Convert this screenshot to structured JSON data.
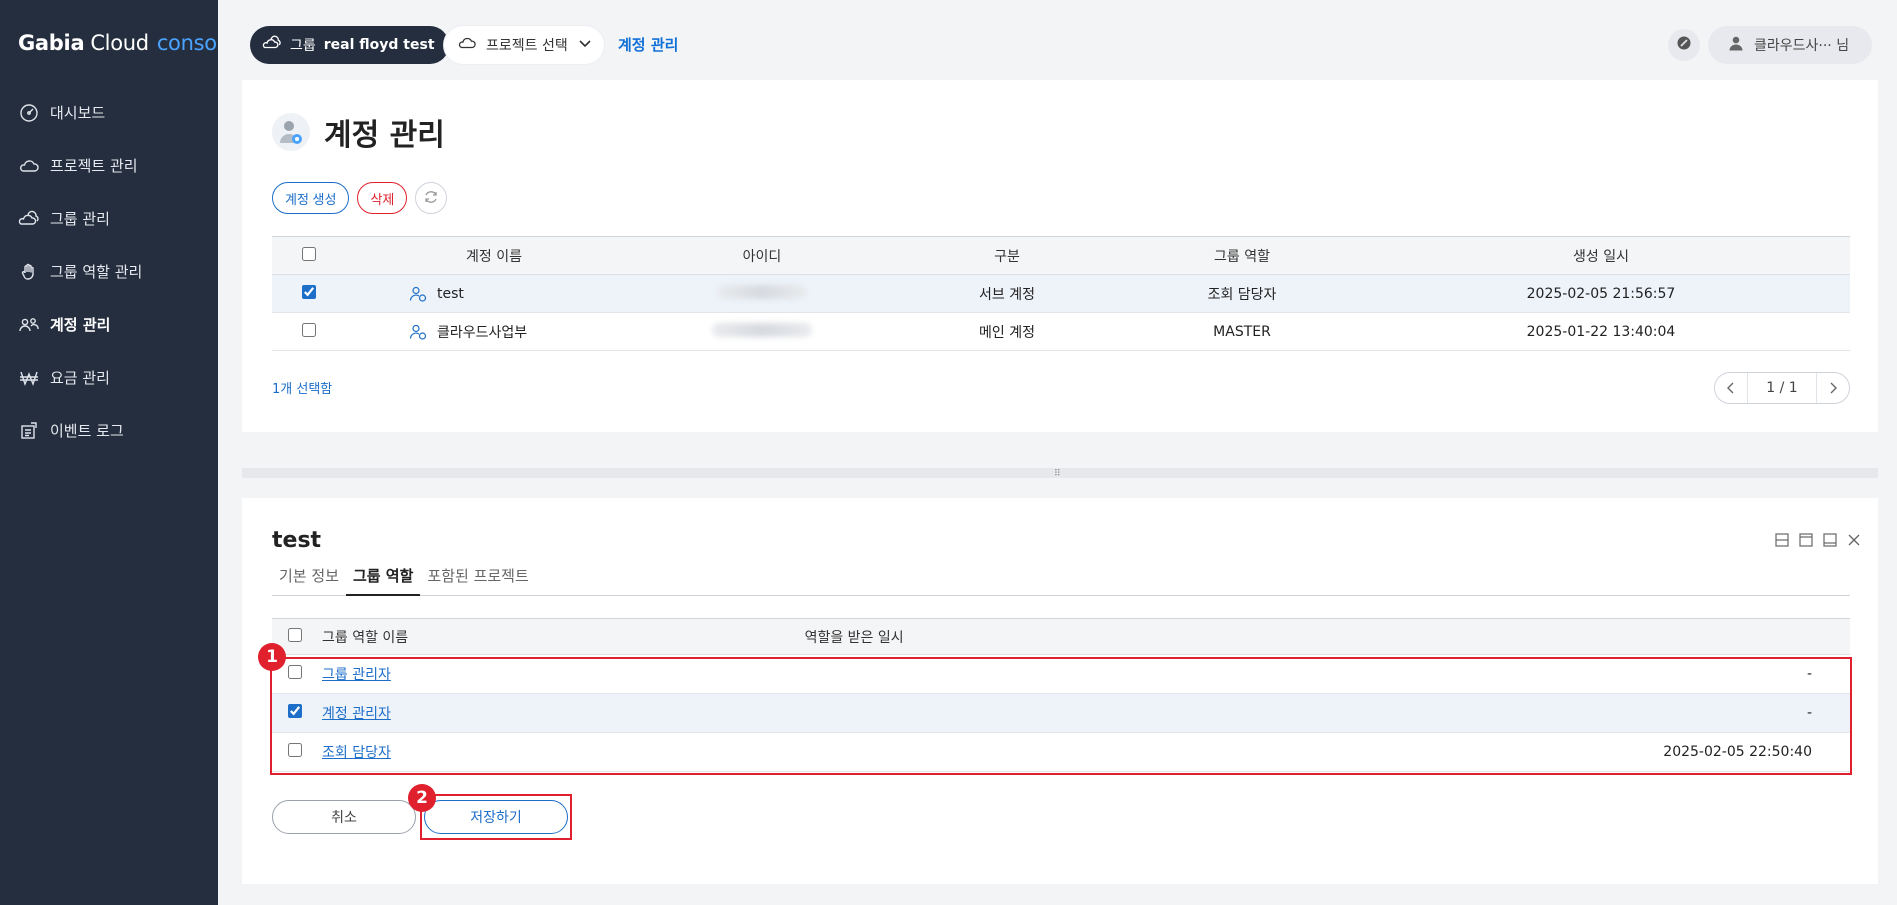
{
  "sidebar": {
    "logo": {
      "brand": "Gabia",
      "product": "Cloud",
      "suffix": "console"
    },
    "items": [
      {
        "label": "대시보드",
        "icon": "dashboard-icon",
        "active": false
      },
      {
        "label": "프로젝트 관리",
        "icon": "cloud-icon",
        "active": false
      },
      {
        "label": "그룹 관리",
        "icon": "group-clouds-icon",
        "active": false
      },
      {
        "label": "그룹 역할 관리",
        "icon": "hand-icon",
        "active": false
      },
      {
        "label": "계정 관리",
        "icon": "users-icon",
        "active": true
      },
      {
        "label": "요금 관리",
        "icon": "won-icon",
        "active": false
      },
      {
        "label": "이벤트 로그",
        "icon": "log-icon",
        "active": false
      }
    ]
  },
  "topbar": {
    "group_label": "그룹",
    "group_name": "real floyd test",
    "project_select": "프로젝트 선택",
    "breadcrumb": "계정 관리",
    "user_name": "클라우드사··· 님"
  },
  "accounts": {
    "title": "계정 관리",
    "create_label": "계정 생성",
    "delete_label": "삭제",
    "columns": [
      "계정 이름",
      "아이디",
      "구분",
      "그룹 역할",
      "생성 일시"
    ],
    "rows": [
      {
        "name": "test",
        "type": "서브 계정",
        "role": "조회 담당자",
        "created": "2025-02-05 21:56:57",
        "checked": true
      },
      {
        "name": "클라우드사업부",
        "type": "메인 계정",
        "role": "MASTER",
        "created": "2025-01-22 13:40:04",
        "checked": false
      }
    ],
    "selected_count": "1개 선택함",
    "pagination": "1 / 1"
  },
  "detail": {
    "title": "test",
    "tabs": [
      "기본 정보",
      "그룹 역할",
      "포함된 프로젝트"
    ],
    "active_tab": 1,
    "columns": [
      "그룹 역할 이름",
      "역할을 받은 일시"
    ],
    "roles": [
      {
        "name": "그룹 관리자",
        "date": "-",
        "checked": false
      },
      {
        "name": "계정 관리자",
        "date": "-",
        "checked": true
      },
      {
        "name": "조회 담당자",
        "date": "2025-02-05 22:50:40",
        "checked": false
      }
    ],
    "cancel_label": "취소",
    "save_label": "저장하기",
    "badge1": "1",
    "badge2": "2"
  },
  "colors": {
    "sidebar_bg": "#252e3e",
    "accent": "#1c6ec9",
    "highlight": "#e0212d"
  }
}
